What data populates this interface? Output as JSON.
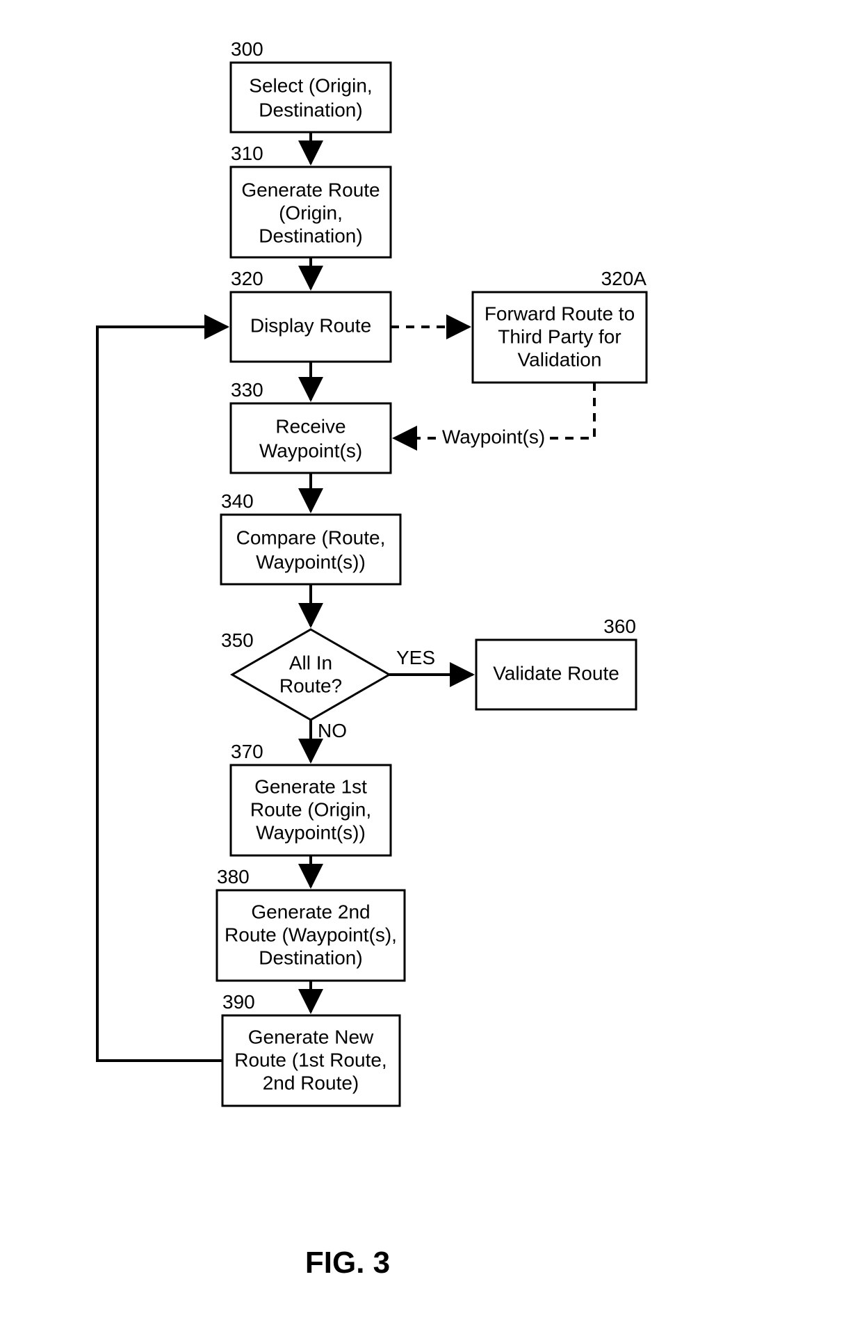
{
  "figure_label": "FIG. 3",
  "nodes": {
    "n300": {
      "ref": "300",
      "line1": "Select (Origin,",
      "line2": "Destination)"
    },
    "n310": {
      "ref": "310",
      "line1": "Generate Route",
      "line2": "(Origin,",
      "line3": "Destination)"
    },
    "n320": {
      "ref": "320",
      "line1": "Display Route"
    },
    "n320a": {
      "ref": "320A",
      "line1": "Forward Route to",
      "line2": "Third Party for",
      "line3": "Validation"
    },
    "n330": {
      "ref": "330",
      "line1": "Receive",
      "line2": "Waypoint(s)"
    },
    "n340": {
      "ref": "340",
      "line1": "Compare (Route,",
      "line2": "Waypoint(s))"
    },
    "n350": {
      "ref": "350",
      "line1": "All In",
      "line2": "Route?"
    },
    "n360": {
      "ref": "360",
      "line1": "Validate Route"
    },
    "n370": {
      "ref": "370",
      "line1": "Generate 1st",
      "line2": "Route (Origin,",
      "line3": "Waypoint(s))"
    },
    "n380": {
      "ref": "380",
      "line1": "Generate 2nd",
      "line2": "Route (Waypoint(s),",
      "line3": "Destination)"
    },
    "n390": {
      "ref": "390",
      "line1": "Generate New",
      "line2": "Route (1st Route,",
      "line3": "2nd Route)"
    }
  },
  "edges": {
    "yes": "YES",
    "no": "NO",
    "waypoints": "Waypoint(s)"
  }
}
